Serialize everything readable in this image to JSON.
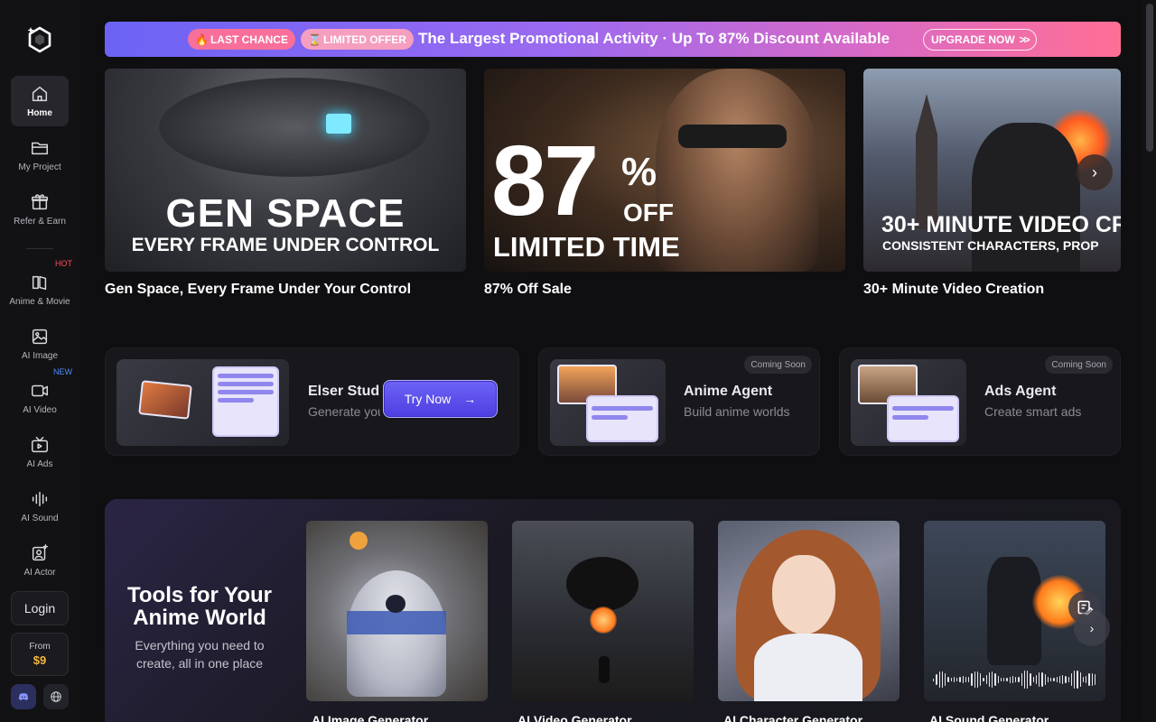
{
  "sidebar": {
    "items": [
      {
        "label": "Home",
        "icon": "home-icon",
        "active": true
      },
      {
        "label": "My Project",
        "icon": "folder-icon"
      },
      {
        "label": "Refer & Earn",
        "icon": "gift-icon"
      },
      {
        "label": "Anime & Movie",
        "icon": "book-open-icon",
        "badge": "HOT"
      },
      {
        "label": "AI Image",
        "icon": "image-icon"
      },
      {
        "label": "AI Video",
        "icon": "video-icon",
        "badge": "NEW"
      },
      {
        "label": "AI Ads",
        "icon": "tv-icon"
      },
      {
        "label": "AI Sound",
        "icon": "sound-wave-icon"
      },
      {
        "label": "AI Actor",
        "icon": "actor-icon"
      }
    ],
    "login": "Login",
    "pricing": {
      "from": "From",
      "price": "$9"
    },
    "colors": {
      "hot": "#ff4d5e",
      "new": "#4d8dff",
      "price": "#f5b73b"
    }
  },
  "promo": {
    "last_chance": "LAST CHANCE",
    "limited_offer": "LIMITED OFFER",
    "headline": "The Largest Promotional Activity · Up To 87% Discount Available",
    "cta": "UPGRADE NOW",
    "cta_icon": "double-chevron-right-icon"
  },
  "banners": [
    {
      "line1": "GEN SPACE",
      "line2": "EVERY FRAME UNDER CONTROL",
      "caption": "Gen Space, Every Frame Under Your Control"
    },
    {
      "big": "87",
      "pct": "%",
      "off": "OFF",
      "line2": "LIMITED TIME",
      "caption": "87% Off Sale"
    },
    {
      "line1": "30+ MINUTE VIDEO CR",
      "line2": "CONSISTENT CHARACTERS, PROP",
      "caption": "30+ Minute Video Creation"
    }
  ],
  "agents": [
    {
      "title": "Elser Studi",
      "subtitle": "Generate you",
      "cta": "Try Now"
    },
    {
      "title": "Anime Agent",
      "subtitle": "Build anime worlds",
      "badge": "Coming Soon"
    },
    {
      "title": "Ads Agent",
      "subtitle": "Create smart ads",
      "badge": "Coming Soon"
    }
  ],
  "tools": {
    "title_line1": "Tools for Your",
    "title_line2": "Anime World",
    "subtitle_line1": "Everything you need to",
    "subtitle_line2": "create, all in one place",
    "cards": [
      {
        "label": "AI Image Generator"
      },
      {
        "label": "AI Video Generator"
      },
      {
        "label": "AI Character Generator"
      },
      {
        "label": "AI Sound Generator"
      }
    ]
  }
}
